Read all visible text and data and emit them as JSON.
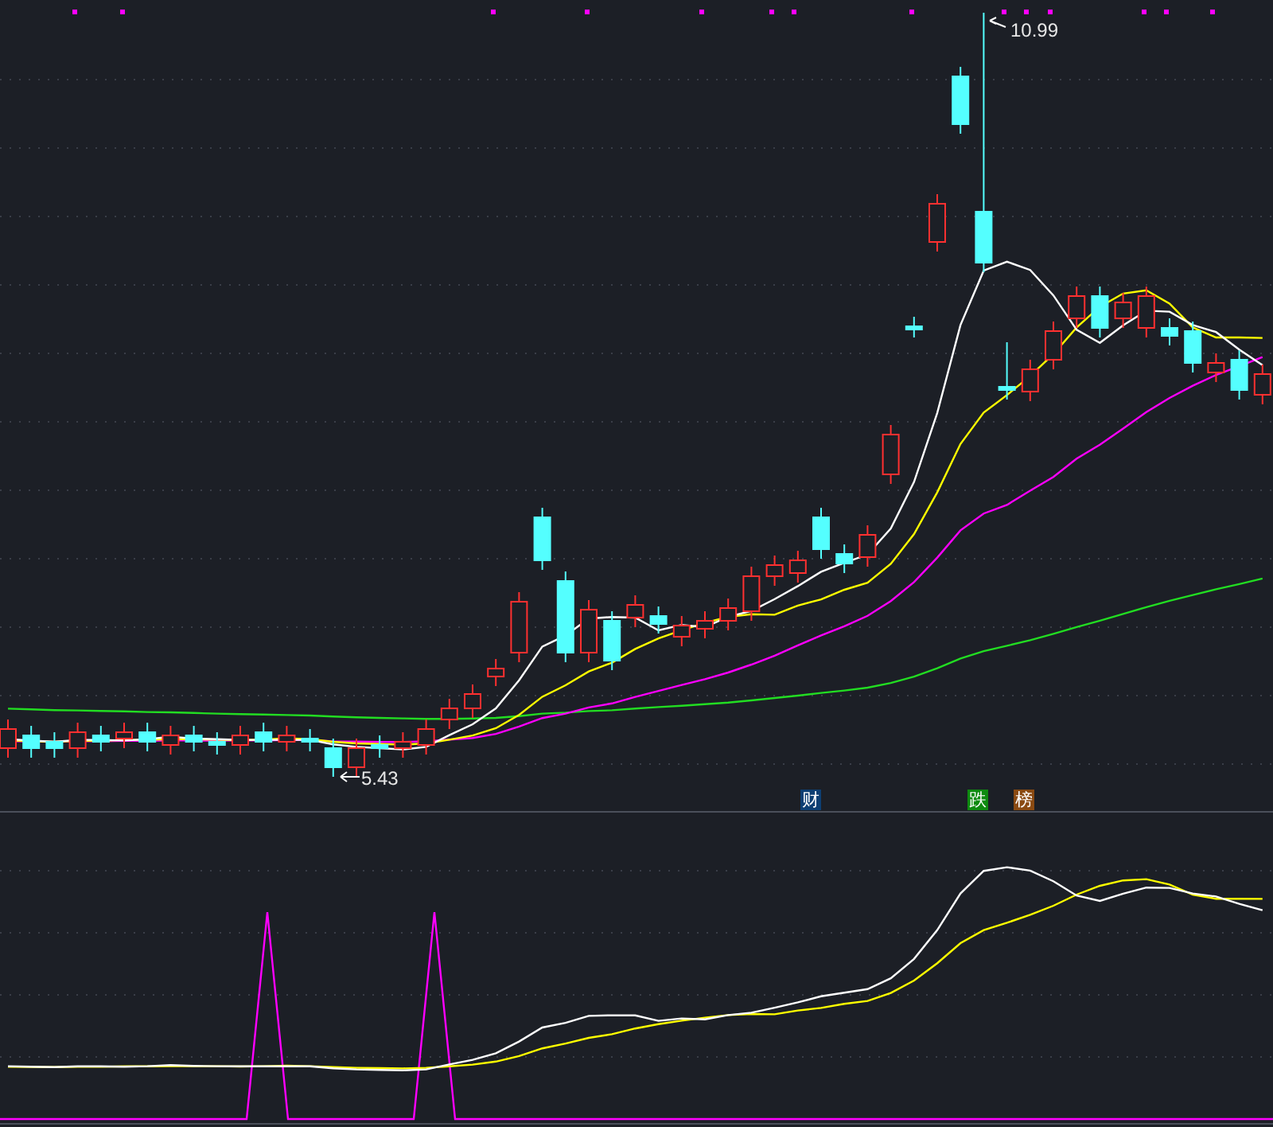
{
  "price_chart": {
    "high_label": "10.99",
    "low_label": "5.43"
  },
  "event_tags": [
    {
      "label": "财",
      "color": "#0d3f73"
    },
    {
      "label": "跌",
      "color": "#0e8a10"
    },
    {
      "label": "榜",
      "color": "#8a4a12"
    }
  ]
}
